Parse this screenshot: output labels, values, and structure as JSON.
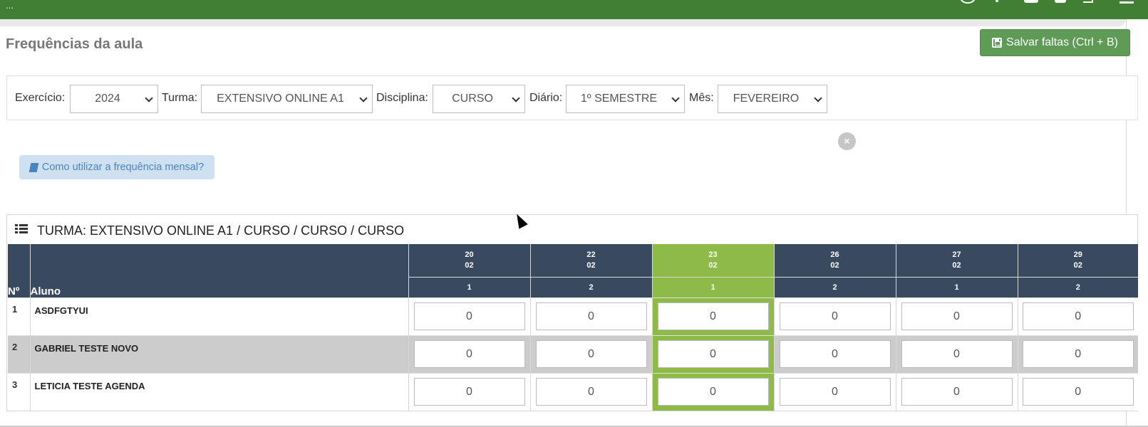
{
  "topbar": {
    "menu_dots": "..."
  },
  "page": {
    "title": "Frequências da aula"
  },
  "toolbar": {
    "save_label": "Salvar faltas (Ctrl + B)"
  },
  "filters": {
    "exercicio": {
      "label": "Exercício:",
      "value": "2024"
    },
    "turma": {
      "label": "Turma:",
      "value": "EXTENSIVO ONLINE A1"
    },
    "disciplina": {
      "label": "Disciplina:",
      "value": "CURSO"
    },
    "diario": {
      "label": "Diário:",
      "value": "1º SEMESTRE"
    },
    "mes": {
      "label": "Mês:",
      "value": "FEVEREIRO"
    }
  },
  "alert": {
    "close_label": "×"
  },
  "help": {
    "label": "Como utilizar a frequência mensal?"
  },
  "panel": {
    "title": "TURMA: EXTENSIVO ONLINE A1 / CURSO / CURSO / CURSO"
  },
  "table": {
    "col_no": "Nº",
    "col_aluno": "Aluno",
    "dates": [
      {
        "day": "20",
        "month": "02",
        "num": "1"
      },
      {
        "day": "22",
        "month": "02",
        "num": "2"
      },
      {
        "day": "23",
        "month": "02",
        "num": "1"
      },
      {
        "day": "26",
        "month": "02",
        "num": "2"
      },
      {
        "day": "27",
        "month": "02",
        "num": "1"
      },
      {
        "day": "29",
        "month": "02",
        "num": "2"
      }
    ],
    "active_date_index": 2,
    "rows": [
      {
        "no": "1",
        "name": "ASDFGTYUI",
        "values": [
          "0",
          "0",
          "0",
          "0",
          "0",
          "0"
        ]
      },
      {
        "no": "2",
        "name": "GABRIEL TESTE NOVO",
        "values": [
          "0",
          "0",
          "0",
          "0",
          "0",
          "0"
        ]
      },
      {
        "no": "3",
        "name": "LETICIA TESTE AGENDA",
        "values": [
          "0",
          "0",
          "0",
          "0",
          "0",
          "0"
        ]
      }
    ]
  },
  "colors": {
    "topbar": "#417f35",
    "header": "#394a60",
    "active": "#8ebb47",
    "save_button": "#5f9a57"
  }
}
